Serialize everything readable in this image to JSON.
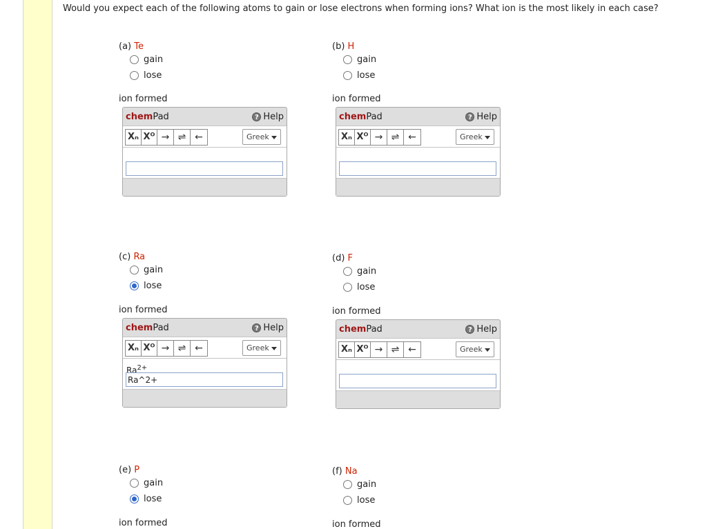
{
  "question": "Would you expect each of the following atoms to gain or lose electrons when forming ions? What ion is the most likely in each case?",
  "ion_formed_label": "ion formed",
  "chempad": {
    "title_bold": "chem",
    "title_rest": "Pad",
    "help_label": "Help",
    "help_icon": "?",
    "tools": {
      "subscript": "Xₐ",
      "superscript": "X°",
      "arrow_right": "→",
      "arrow_equilibrium": "⇌",
      "arrow_left": "←"
    },
    "greek_label": "Greek"
  },
  "parts": [
    {
      "label": "(a)",
      "element": "Te",
      "options": [
        "gain",
        "lose"
      ],
      "selected": null,
      "preview": "",
      "preview_sup": "",
      "answer": ""
    },
    {
      "label": "(b)",
      "element": "H",
      "options": [
        "gain",
        "lose"
      ],
      "selected": null,
      "preview": "",
      "preview_sup": "",
      "answer": ""
    },
    {
      "label": "(c)",
      "element": "Ra",
      "options": [
        "gain",
        "lose"
      ],
      "selected": "lose",
      "preview": "Ra",
      "preview_sup": "2+",
      "answer": "Ra^2+"
    },
    {
      "label": "(d)",
      "element": "F",
      "options": [
        "gain",
        "lose"
      ],
      "selected": null,
      "preview": "",
      "preview_sup": "",
      "answer": ""
    },
    {
      "label": "(e)",
      "element": "P",
      "options": [
        "gain",
        "lose"
      ],
      "selected": "lose",
      "preview": "",
      "preview_sup": "",
      "answer": ""
    },
    {
      "label": "(f)",
      "element": "Na",
      "options": [
        "gain",
        "lose"
      ],
      "selected": null,
      "preview": "",
      "preview_sup": "",
      "answer": ""
    }
  ]
}
